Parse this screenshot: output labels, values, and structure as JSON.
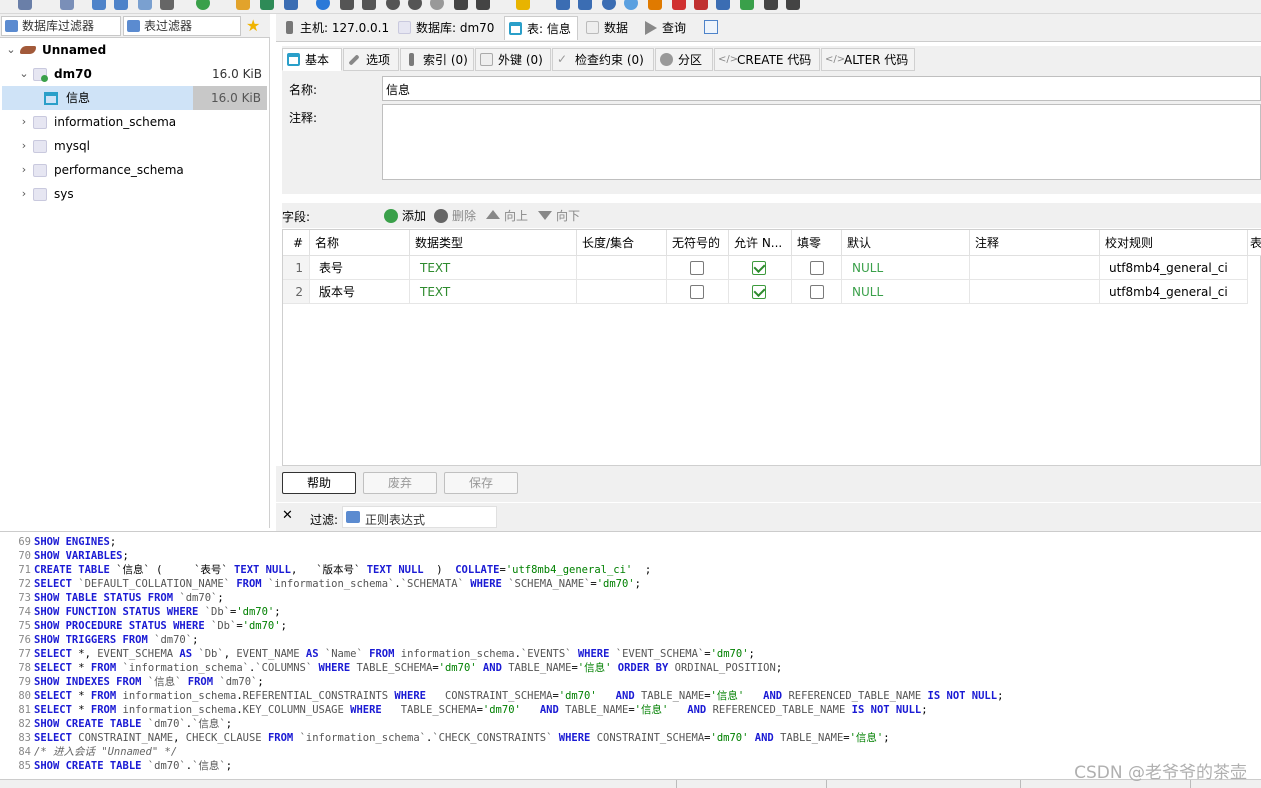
{
  "filter_tabs": {
    "db_filter": "数据库过滤器",
    "table_filter": "表过滤器"
  },
  "tree": {
    "items": [
      {
        "label": "Unnamed",
        "size": ""
      },
      {
        "label": "dm70",
        "size": "16.0 KiB"
      },
      {
        "label": "信息",
        "size": "16.0 KiB"
      },
      {
        "label": "information_schema",
        "size": ""
      },
      {
        "label": "mysql",
        "size": ""
      },
      {
        "label": "performance_schema",
        "size": ""
      },
      {
        "label": "sys",
        "size": ""
      }
    ]
  },
  "main_tabs": {
    "host": "主机: 127.0.0.1",
    "database": "数据库: dm70",
    "table": "表: 信息",
    "data": "数据",
    "query": "查询"
  },
  "sub_tabs": {
    "basic": "基本",
    "options": "选项",
    "indexes": "索引 (0)",
    "foreign_keys": "外键 (0)",
    "check": "检查约束 (0)",
    "partition": "分区",
    "create_code": "CREATE 代码",
    "alter_code": "ALTER 代码"
  },
  "basic": {
    "name_label": "名称:",
    "name_value": "信息",
    "comment_label": "注释:",
    "comment_value": ""
  },
  "fields_bar": {
    "label": "字段:",
    "add": "添加",
    "delete": "删除",
    "up": "向上",
    "down": "向下"
  },
  "grid": {
    "headers": [
      "#",
      "名称",
      "数据类型",
      "长度/集合",
      "无符号的",
      "允许 N...",
      "填零",
      "默认",
      "注释",
      "校对规则",
      "表"
    ],
    "rows": [
      {
        "num": "1",
        "name": "表号",
        "type": "TEXT",
        "length": "",
        "unsigned": false,
        "allow_null": true,
        "zerofill": false,
        "default": "NULL",
        "comment": "",
        "collation": "utf8mb4_general_ci"
      },
      {
        "num": "2",
        "name": "版本号",
        "type": "TEXT",
        "length": "",
        "unsigned": false,
        "allow_null": true,
        "zerofill": false,
        "default": "NULL",
        "comment": "",
        "collation": "utf8mb4_general_ci"
      }
    ]
  },
  "actions": {
    "help": "帮助",
    "discard": "废弃",
    "save": "保存"
  },
  "filter_row": {
    "close": "✕",
    "label": "过滤:",
    "placeholder": "正则表达式"
  },
  "log_lines": [
    {
      "no": "69",
      "html": "<span class='kw'>SHOW ENGINES</span>;"
    },
    {
      "no": "70",
      "html": "<span class='kw'>SHOW VARIABLES</span>;"
    },
    {
      "no": "71",
      "html": "<span class='kw'>CREATE TABLE</span> `信息` (     `表号` <span class='kw'>TEXT NULL</span>,   `版本号` <span class='kw'>TEXT NULL</span>  )  <span class='kw'>COLLATE</span>=<span class='str'>'utf8mb4_general_ci'</span>  ;"
    },
    {
      "no": "72",
      "html": "<span class='kw'>SELECT</span> <span class='idn'>`DEFAULT_COLLATION_NAME`</span> <span class='kw'>FROM</span> <span class='idn'>`information_schema`</span>.<span class='idn'>`SCHEMATA`</span> <span class='kw'>WHERE</span> <span class='idn'>`SCHEMA_NAME`</span>=<span class='str'>'dm70'</span>;"
    },
    {
      "no": "73",
      "html": "<span class='kw'>SHOW TABLE STATUS FROM</span> <span class='idn'>`dm70`</span>;"
    },
    {
      "no": "74",
      "html": "<span class='kw'>SHOW FUNCTION STATUS WHERE</span> <span class='idn'>`Db`</span>=<span class='str'>'dm70'</span>;"
    },
    {
      "no": "75",
      "html": "<span class='kw'>SHOW PROCEDURE STATUS WHERE</span> <span class='idn'>`Db`</span>=<span class='str'>'dm70'</span>;"
    },
    {
      "no": "76",
      "html": "<span class='kw'>SHOW TRIGGERS FROM</span> <span class='idn'>`dm70`</span>;"
    },
    {
      "no": "77",
      "html": "<span class='kw'>SELECT</span> *, <span class='idn'>EVENT_SCHEMA</span> <span class='kw'>AS</span> <span class='idn'>`Db`</span>, <span class='idn'>EVENT_NAME</span> <span class='kw'>AS</span> <span class='idn'>`Name`</span> <span class='kw'>FROM</span> <span class='idn'>information_schema</span>.<span class='idn'>`EVENTS`</span> <span class='kw'>WHERE</span> <span class='idn'>`EVENT_SCHEMA`</span>=<span class='str'>'dm70'</span>;"
    },
    {
      "no": "78",
      "html": "<span class='kw'>SELECT</span> * <span class='kw'>FROM</span> <span class='idn'>`information_schema`</span>.<span class='idn'>`COLUMNS`</span> <span class='kw'>WHERE</span> <span class='idn'>TABLE_SCHEMA</span>=<span class='str'>'dm70'</span> <span class='kw'>AND</span> <span class='idn'>TABLE_NAME</span>=<span class='str'>'信息'</span> <span class='kw'>ORDER BY</span> <span class='idn'>ORDINAL_POSITION</span>;"
    },
    {
      "no": "79",
      "html": "<span class='kw'>SHOW INDEXES FROM</span> <span class='idn'>`信息`</span> <span class='kw'>FROM</span> <span class='idn'>`dm70`</span>;"
    },
    {
      "no": "80",
      "html": "<span class='kw'>SELECT</span> * <span class='kw'>FROM</span> <span class='idn'>information_schema</span>.<span class='idn'>REFERENTIAL_CONSTRAINTS</span> <span class='kw'>WHERE</span>   <span class='idn'>CONSTRAINT_SCHEMA</span>=<span class='str'>'dm70'</span>   <span class='kw'>AND</span> <span class='idn'>TABLE_NAME</span>=<span class='str'>'信息'</span>   <span class='kw'>AND</span> <span class='idn'>REFERENCED_TABLE_NAME</span> <span class='kw'>IS NOT NULL</span>;"
    },
    {
      "no": "81",
      "html": "<span class='kw'>SELECT</span> * <span class='kw'>FROM</span> <span class='idn'>information_schema</span>.<span class='idn'>KEY_COLUMN_USAGE</span> <span class='kw'>WHERE</span>   <span class='idn'>TABLE_SCHEMA</span>=<span class='str'>'dm70'</span>   <span class='kw'>AND</span> <span class='idn'>TABLE_NAME</span>=<span class='str'>'信息'</span>   <span class='kw'>AND</span> <span class='idn'>REFERENCED_TABLE_NAME</span> <span class='kw'>IS NOT NULL</span>;"
    },
    {
      "no": "82",
      "html": "<span class='kw'>SHOW CREATE TABLE</span> <span class='idn'>`dm70`</span>.<span class='idn'>`信息`</span>;"
    },
    {
      "no": "83",
      "html": "<span class='kw'>SELECT</span> <span class='idn'>CONSTRAINT_NAME</span>, <span class='idn'>CHECK_CLAUSE</span> <span class='kw'>FROM</span> <span class='idn'>`information_schema`</span>.<span class='idn'>`CHECK_CONSTRAINTS`</span> <span class='kw'>WHERE</span> <span class='idn'>CONSTRAINT_SCHEMA</span>=<span class='str'>'dm70'</span> <span class='kw'>AND</span> <span class='idn'>TABLE_NAME</span>=<span class='str'>'信息'</span>;"
    },
    {
      "no": "84",
      "html": "<span class='cm'>/* 进入会话 \"Unnamed\" */</span>"
    },
    {
      "no": "85",
      "html": "<span class='kw'>SHOW CREATE TABLE</span> <span class='idn'>`dm70`</span>.<span class='idn'>`信息`</span>;"
    }
  ],
  "watermark": "CSDN @老爷爷的茶壶",
  "colors": {
    "accent": "#1a1ad4",
    "green": "#2e8b2e",
    "string": "#008000"
  }
}
